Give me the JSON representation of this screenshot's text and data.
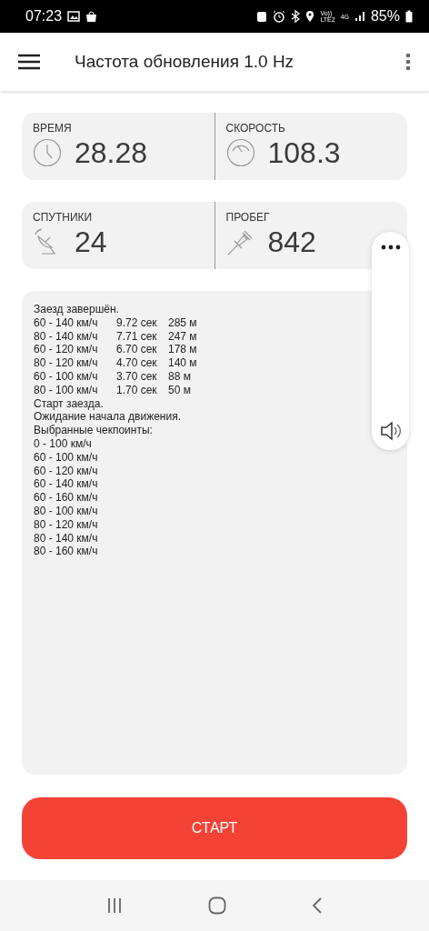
{
  "status_bar": {
    "time": "07:23",
    "volte_top": "Vo))",
    "volte_bottom": "LTE2",
    "network": "4G",
    "battery": "85%"
  },
  "app_bar": {
    "title": "Частота обновления 1.0 Hz"
  },
  "stats": [
    [
      {
        "label": "ВРЕМЯ",
        "value": "28.28",
        "kind": "clock"
      },
      {
        "label": "СКОРОСТЬ",
        "value": "108.3",
        "kind": "gauge"
      }
    ],
    [
      {
        "label": "СПУТНИКИ",
        "value": "24",
        "kind": "satellite"
      },
      {
        "label": "ПРОБЕГ",
        "value": "842",
        "kind": "pin"
      }
    ]
  ],
  "log": [
    {
      "kind": "text",
      "text": "Заезд завершён."
    },
    {
      "kind": "result",
      "range": "60 - 140 км/ч",
      "time": "9.72 сек",
      "distance": "285 м"
    },
    {
      "kind": "result",
      "range": "80 - 140 км/ч",
      "time": "7.71 сек",
      "distance": "247 м"
    },
    {
      "kind": "result",
      "range": "60 - 120 км/ч",
      "time": "6.70 сек",
      "distance": "178 м"
    },
    {
      "kind": "result",
      "range": "80 - 120 км/ч",
      "time": "4.70 сек",
      "distance": "140 м"
    },
    {
      "kind": "result",
      "range": "60 - 100 км/ч",
      "time": "3.70 сек",
      "distance": "88 м"
    },
    {
      "kind": "result",
      "range": "80 - 100 км/ч",
      "time": "1.70 сек",
      "distance": "50 м"
    },
    {
      "kind": "text",
      "text": "Старт заезда."
    },
    {
      "kind": "text",
      "text": "Ожидание начала движения."
    },
    {
      "kind": "text",
      "text": "Выбранные чекпоинты:"
    },
    {
      "kind": "text",
      "text": "0 - 100 км/ч"
    },
    {
      "kind": "text",
      "text": "60 - 100 км/ч"
    },
    {
      "kind": "text",
      "text": "60 - 120 км/ч"
    },
    {
      "kind": "text",
      "text": "60 - 140 км/ч"
    },
    {
      "kind": "text",
      "text": "60 - 160 км/ч"
    },
    {
      "kind": "text",
      "text": "80 - 100 км/ч"
    },
    {
      "kind": "text",
      "text": "80 - 120 км/ч"
    },
    {
      "kind": "text",
      "text": "80 - 140 км/ч"
    },
    {
      "kind": "text",
      "text": "80 - 160 км/ч"
    }
  ],
  "start_button": {
    "label": "СТАРТ"
  }
}
